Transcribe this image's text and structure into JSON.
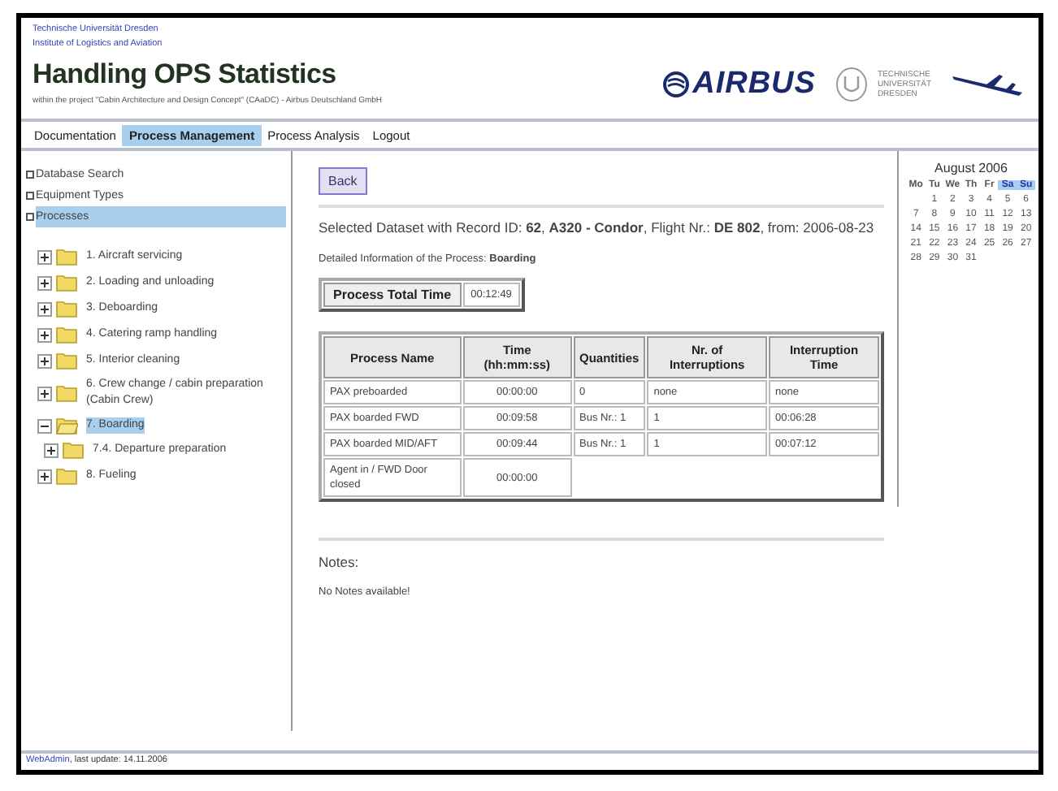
{
  "header": {
    "institution": [
      "Technische Universität Dresden",
      "Institute of Logistics and Aviation"
    ],
    "title": "Handling OPS Statistics",
    "subtitle": "within the project \"Cabin Architecture and Design Concept\" (CAaDC) - Airbus Deutschland GmbH",
    "airbus_logo": "AIRBUS",
    "tu_logo": [
      "TECHNISCHE",
      "UNIVERSITÄT",
      "DRESDEN"
    ]
  },
  "nav": [
    {
      "label": "Documentation",
      "selected": false
    },
    {
      "label": "Process Management",
      "selected": true
    },
    {
      "label": "Process Analysis",
      "selected": false
    },
    {
      "label": "Logout",
      "selected": false
    }
  ],
  "sidebar": {
    "links": [
      {
        "label": "Database Search",
        "selected": false
      },
      {
        "label": "Equipment Types",
        "selected": false
      },
      {
        "label": "Processes",
        "selected": true
      }
    ],
    "tree": [
      {
        "label": "1. Aircraft servicing",
        "expanded": false,
        "selected": false
      },
      {
        "label": "2. Loading and unloading",
        "expanded": false,
        "selected": false
      },
      {
        "label": "3. Deboarding",
        "expanded": false,
        "selected": false
      },
      {
        "label": "4. Catering ramp handling",
        "expanded": false,
        "selected": false
      },
      {
        "label": "5. Interior cleaning",
        "expanded": false,
        "selected": false
      },
      {
        "label": "6. Crew change / cabin preparation (Cabin Crew)",
        "expanded": false,
        "selected": false
      },
      {
        "label": "7. Boarding",
        "expanded": true,
        "selected": true,
        "children": [
          {
            "label": "7.4. Departure preparation",
            "expanded": false,
            "selected": false
          }
        ]
      },
      {
        "label": "8. Fueling",
        "expanded": false,
        "selected": false
      }
    ]
  },
  "main": {
    "back_button": "Back",
    "dataset": "Selected Dataset with Record ID: **62**, **A320 - Condor**, Flight Nr.: **DE 802**, from: 2006-08-23",
    "process_info": "Detailed Information of the Process: **Boarding**",
    "total_label": "Process Total Time",
    "total_value": "00:12:49",
    "table": {
      "columns": [
        "Process Name",
        "Time (hh:mm:ss)",
        "Quantities",
        "Nr. of Interruptions",
        "Interruption Time"
      ],
      "rows": [
        [
          "PAX preboarded",
          "00:00:00",
          "0",
          "none",
          "none"
        ],
        [
          "PAX boarded FWD",
          "00:09:58",
          "Bus Nr.: 1",
          "1",
          "00:06:28"
        ],
        [
          "PAX boarded MID/AFT",
          "00:09:44",
          "Bus Nr.: 1",
          "1",
          "00:07:12"
        ],
        [
          "Agent in / FWD Door closed",
          "00:00:00"
        ]
      ]
    },
    "notes_label": "Notes:",
    "notes_text": "No Notes available!"
  },
  "calendar": {
    "title": "August 2006",
    "weekdays": [
      {
        "label": "Mo",
        "highlighted": false
      },
      {
        "label": "Tu",
        "highlighted": false
      },
      {
        "label": "We",
        "highlighted": false
      },
      {
        "label": "Th",
        "highlighted": false
      },
      {
        "label": "Fr",
        "highlighted": false
      },
      {
        "label": "Sa",
        "highlighted": true
      },
      {
        "label": "Su",
        "highlighted": true
      }
    ],
    "weeks": [
      [
        "1",
        "2",
        "3",
        "4",
        "5",
        "6"
      ],
      [
        "7",
        "8",
        "9",
        "10",
        "11",
        "12",
        "13"
      ],
      [
        "14",
        "15",
        "16",
        "17",
        "18",
        "19",
        "20"
      ],
      [
        "21",
        "22",
        "23",
        "24",
        "25",
        "26",
        "27"
      ],
      [
        "28",
        "29",
        "30",
        "31"
      ]
    ]
  },
  "footer": {
    "link": "WebAdmin",
    "text": ", last update: 14.11.2006"
  }
}
